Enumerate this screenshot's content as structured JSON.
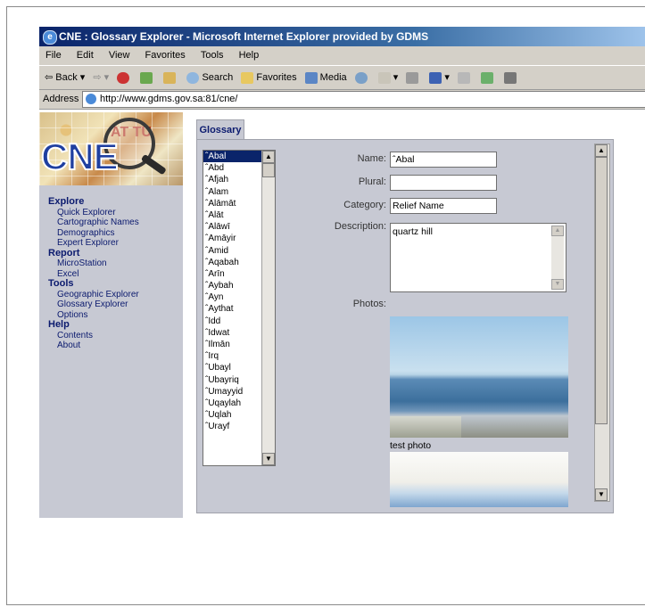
{
  "window": {
    "title": "CNE : Glossary Explorer - Microsoft Internet Explorer provided by GDMS"
  },
  "menu": [
    "File",
    "Edit",
    "View",
    "Favorites",
    "Tools",
    "Help"
  ],
  "toolbar": {
    "back": "Back",
    "search": "Search",
    "favorites": "Favorites",
    "media": "Media"
  },
  "address": {
    "label": "Address",
    "url": "http://www.gdms.gov.sa:81/cne/"
  },
  "logo": {
    "text": "CNE",
    "map_text": "AT TU"
  },
  "nav": {
    "explore": {
      "label": "Explore",
      "items": [
        "Quick Explorer",
        "Cartographic Names",
        "Demographics",
        "Expert Explorer"
      ]
    },
    "report": {
      "label": "Report",
      "items": [
        "MicroStation",
        "Excel"
      ]
    },
    "tools": {
      "label": "Tools",
      "items": [
        "Geographic Explorer",
        "Glossary Explorer",
        "Options"
      ]
    },
    "help": {
      "label": "Help",
      "items": [
        "Contents",
        "About"
      ]
    }
  },
  "tab": {
    "label": "Glossary"
  },
  "glossary_list": [
    "ˆAbal",
    "ˆAbd",
    "ˆAfjah",
    "ˆAlam",
    "ˆAlāmāt",
    "ˆAlāt",
    "ˆAlāwī",
    "ˆAmāyir",
    "ˆAmid",
    "ˆAqabah",
    "ˆArīn",
    "ˆAybah",
    "ˆAyn",
    "ˆAythat",
    "ˆIdd",
    "ˆIdwat",
    "ˆIlmān",
    "ˆIrq",
    "ˆUbayl",
    "ˆUbayriq",
    "ˆUmayyid",
    "ˆUqaylah",
    "ˆUqlah",
    "ˆUrayf"
  ],
  "form": {
    "name_label": "Name:",
    "name_value": "ˆAbal",
    "plural_label": "Plural:",
    "plural_value": "",
    "category_label": "Category:",
    "category_value": "Relief Name",
    "description_label": "Description:",
    "description_value": "quartz hill",
    "photos_label": "Photos:",
    "photo_caption": "test photo"
  },
  "colors": {
    "titlebar": "#0a246a",
    "nav_text": "#0b1a6e",
    "panel_bg": "#c7c9d3",
    "selection": "#0a246a"
  }
}
